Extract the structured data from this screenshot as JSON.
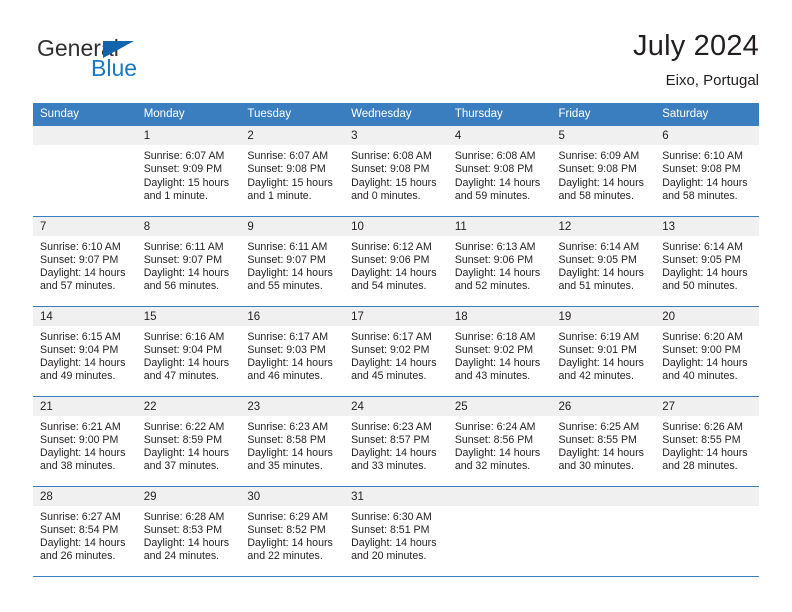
{
  "brand": {
    "name_part1": "General",
    "name_part2": "Blue",
    "triangle_color": "#1265ad",
    "blue_color": "#1878c8"
  },
  "header": {
    "title": "July 2024",
    "location": "Eixo, Portugal"
  },
  "theme": {
    "header_blue": "#3b7ebf",
    "daynum_bg": "#f0f0f0",
    "text": "#231f20"
  },
  "weekday_headers": [
    "Sunday",
    "Monday",
    "Tuesday",
    "Wednesday",
    "Thursday",
    "Friday",
    "Saturday"
  ],
  "weeks": [
    [
      {
        "day": "",
        "empty": true,
        "sunrise": "",
        "sunset": "",
        "daylight": ""
      },
      {
        "day": "1",
        "sunrise": "Sunrise: 6:07 AM",
        "sunset": "Sunset: 9:09 PM",
        "daylight": "Daylight: 15 hours and 1 minute."
      },
      {
        "day": "2",
        "sunrise": "Sunrise: 6:07 AM",
        "sunset": "Sunset: 9:08 PM",
        "daylight": "Daylight: 15 hours and 1 minute."
      },
      {
        "day": "3",
        "sunrise": "Sunrise: 6:08 AM",
        "sunset": "Sunset: 9:08 PM",
        "daylight": "Daylight: 15 hours and 0 minutes."
      },
      {
        "day": "4",
        "sunrise": "Sunrise: 6:08 AM",
        "sunset": "Sunset: 9:08 PM",
        "daylight": "Daylight: 14 hours and 59 minutes."
      },
      {
        "day": "5",
        "sunrise": "Sunrise: 6:09 AM",
        "sunset": "Sunset: 9:08 PM",
        "daylight": "Daylight: 14 hours and 58 minutes."
      },
      {
        "day": "6",
        "sunrise": "Sunrise: 6:10 AM",
        "sunset": "Sunset: 9:08 PM",
        "daylight": "Daylight: 14 hours and 58 minutes."
      }
    ],
    [
      {
        "day": "7",
        "sunrise": "Sunrise: 6:10 AM",
        "sunset": "Sunset: 9:07 PM",
        "daylight": "Daylight: 14 hours and 57 minutes."
      },
      {
        "day": "8",
        "sunrise": "Sunrise: 6:11 AM",
        "sunset": "Sunset: 9:07 PM",
        "daylight": "Daylight: 14 hours and 56 minutes."
      },
      {
        "day": "9",
        "sunrise": "Sunrise: 6:11 AM",
        "sunset": "Sunset: 9:07 PM",
        "daylight": "Daylight: 14 hours and 55 minutes."
      },
      {
        "day": "10",
        "sunrise": "Sunrise: 6:12 AM",
        "sunset": "Sunset: 9:06 PM",
        "daylight": "Daylight: 14 hours and 54 minutes."
      },
      {
        "day": "11",
        "sunrise": "Sunrise: 6:13 AM",
        "sunset": "Sunset: 9:06 PM",
        "daylight": "Daylight: 14 hours and 52 minutes."
      },
      {
        "day": "12",
        "sunrise": "Sunrise: 6:14 AM",
        "sunset": "Sunset: 9:05 PM",
        "daylight": "Daylight: 14 hours and 51 minutes."
      },
      {
        "day": "13",
        "sunrise": "Sunrise: 6:14 AM",
        "sunset": "Sunset: 9:05 PM",
        "daylight": "Daylight: 14 hours and 50 minutes."
      }
    ],
    [
      {
        "day": "14",
        "sunrise": "Sunrise: 6:15 AM",
        "sunset": "Sunset: 9:04 PM",
        "daylight": "Daylight: 14 hours and 49 minutes."
      },
      {
        "day": "15",
        "sunrise": "Sunrise: 6:16 AM",
        "sunset": "Sunset: 9:04 PM",
        "daylight": "Daylight: 14 hours and 47 minutes."
      },
      {
        "day": "16",
        "sunrise": "Sunrise: 6:17 AM",
        "sunset": "Sunset: 9:03 PM",
        "daylight": "Daylight: 14 hours and 46 minutes."
      },
      {
        "day": "17",
        "sunrise": "Sunrise: 6:17 AM",
        "sunset": "Sunset: 9:02 PM",
        "daylight": "Daylight: 14 hours and 45 minutes."
      },
      {
        "day": "18",
        "sunrise": "Sunrise: 6:18 AM",
        "sunset": "Sunset: 9:02 PM",
        "daylight": "Daylight: 14 hours and 43 minutes."
      },
      {
        "day": "19",
        "sunrise": "Sunrise: 6:19 AM",
        "sunset": "Sunset: 9:01 PM",
        "daylight": "Daylight: 14 hours and 42 minutes."
      },
      {
        "day": "20",
        "sunrise": "Sunrise: 6:20 AM",
        "sunset": "Sunset: 9:00 PM",
        "daylight": "Daylight: 14 hours and 40 minutes."
      }
    ],
    [
      {
        "day": "21",
        "sunrise": "Sunrise: 6:21 AM",
        "sunset": "Sunset: 9:00 PM",
        "daylight": "Daylight: 14 hours and 38 minutes."
      },
      {
        "day": "22",
        "sunrise": "Sunrise: 6:22 AM",
        "sunset": "Sunset: 8:59 PM",
        "daylight": "Daylight: 14 hours and 37 minutes."
      },
      {
        "day": "23",
        "sunrise": "Sunrise: 6:23 AM",
        "sunset": "Sunset: 8:58 PM",
        "daylight": "Daylight: 14 hours and 35 minutes."
      },
      {
        "day": "24",
        "sunrise": "Sunrise: 6:23 AM",
        "sunset": "Sunset: 8:57 PM",
        "daylight": "Daylight: 14 hours and 33 minutes."
      },
      {
        "day": "25",
        "sunrise": "Sunrise: 6:24 AM",
        "sunset": "Sunset: 8:56 PM",
        "daylight": "Daylight: 14 hours and 32 minutes."
      },
      {
        "day": "26",
        "sunrise": "Sunrise: 6:25 AM",
        "sunset": "Sunset: 8:55 PM",
        "daylight": "Daylight: 14 hours and 30 minutes."
      },
      {
        "day": "27",
        "sunrise": "Sunrise: 6:26 AM",
        "sunset": "Sunset: 8:55 PM",
        "daylight": "Daylight: 14 hours and 28 minutes."
      }
    ],
    [
      {
        "day": "28",
        "sunrise": "Sunrise: 6:27 AM",
        "sunset": "Sunset: 8:54 PM",
        "daylight": "Daylight: 14 hours and 26 minutes."
      },
      {
        "day": "29",
        "sunrise": "Sunrise: 6:28 AM",
        "sunset": "Sunset: 8:53 PM",
        "daylight": "Daylight: 14 hours and 24 minutes."
      },
      {
        "day": "30",
        "sunrise": "Sunrise: 6:29 AM",
        "sunset": "Sunset: 8:52 PM",
        "daylight": "Daylight: 14 hours and 22 minutes."
      },
      {
        "day": "31",
        "sunrise": "Sunrise: 6:30 AM",
        "sunset": "Sunset: 8:51 PM",
        "daylight": "Daylight: 14 hours and 20 minutes."
      },
      {
        "day": "",
        "empty": true,
        "sunrise": "",
        "sunset": "",
        "daylight": ""
      },
      {
        "day": "",
        "empty": true,
        "sunrise": "",
        "sunset": "",
        "daylight": ""
      },
      {
        "day": "",
        "empty": true,
        "sunrise": "",
        "sunset": "",
        "daylight": ""
      }
    ]
  ]
}
